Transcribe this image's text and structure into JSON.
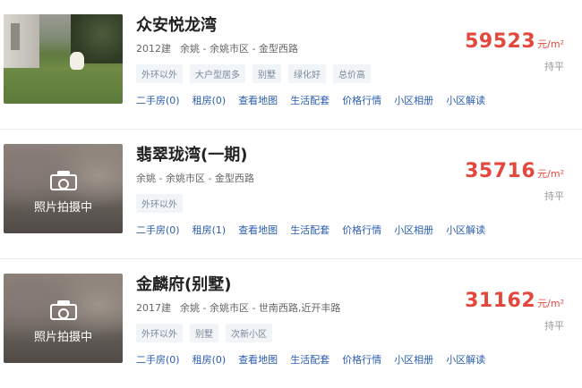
{
  "listings": [
    {
      "name": "众安悦龙湾",
      "year": "2012建",
      "location": "余姚 - 余姚市区 - 金型西路",
      "tags": [
        "外环以外",
        "大户型居多",
        "别墅",
        "绿化好",
        "总价高"
      ],
      "links": [
        "二手房(0)",
        "租房(0)",
        "查看地图",
        "生活配套",
        "价格行情",
        "小区相册",
        "小区解读"
      ],
      "price": "59523",
      "unit": "元/m²",
      "trend": "持平",
      "photo_label": ""
    },
    {
      "name": "翡翠珑湾(一期)",
      "year": "",
      "location": "余姚 - 余姚市区 - 金型西路",
      "tags": [
        "外环以外"
      ],
      "links": [
        "二手房(0)",
        "租房(1)",
        "查看地图",
        "生活配套",
        "价格行情",
        "小区相册",
        "小区解读"
      ],
      "price": "35716",
      "unit": "元/m²",
      "trend": "持平",
      "photo_label": "照片拍摄中"
    },
    {
      "name": "金麟府(别墅)",
      "year": "2017建",
      "location": "余姚 - 余姚市区 - 世南西路,近开丰路",
      "tags": [
        "外环以外",
        "别墅",
        "次新小区"
      ],
      "links": [
        "二手房(0)",
        "租房(0)",
        "查看地图",
        "生活配套",
        "价格行情",
        "小区相册",
        "小区解读"
      ],
      "price": "31162",
      "unit": "元/m²",
      "trend": "持平",
      "photo_label": "照片拍摄中"
    }
  ],
  "colors": {
    "price": "#e4473c",
    "link": "#2a5db0",
    "tag_text": "#7a8799",
    "tag_bg": "#f2f5f8"
  }
}
